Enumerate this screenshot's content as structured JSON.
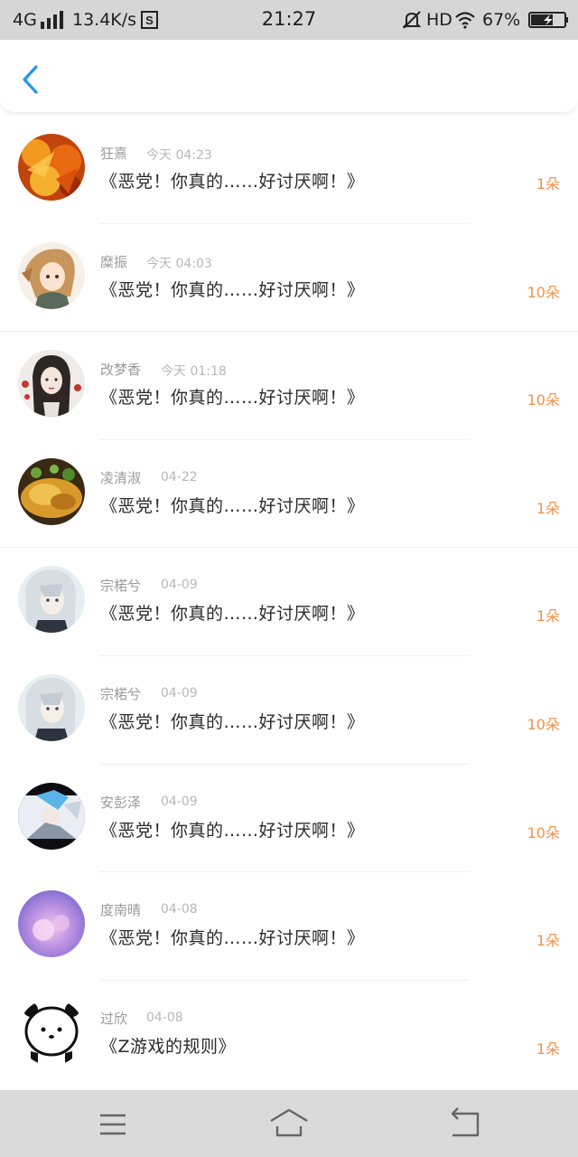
{
  "status_bar": {
    "network": "4G",
    "speed": "13.4K/s",
    "time": "21:27",
    "hd": "HD",
    "battery": "67%"
  },
  "header": {
    "back_icon": "chevron-left-icon",
    "accent": "#2196f3"
  },
  "colors": {
    "count": "#f0924a",
    "name": "#9a9a9a",
    "time": "#b8b8b8"
  },
  "items": [
    {
      "name": "狂熹",
      "time": "今天 04:23",
      "title": "《恶党！你真的……好讨厌啊！》",
      "count": "1朵"
    },
    {
      "name": "糜振",
      "time": "今天 04:03",
      "title": "《恶党！你真的……好讨厌啊！》",
      "count": "10朵"
    },
    {
      "name": "改梦香",
      "time": "今天 01:18",
      "title": "《恶党！你真的……好讨厌啊！》",
      "count": "10朵"
    },
    {
      "name": "凌清淑",
      "time": "04-22",
      "title": "《恶党！你真的……好讨厌啊！》",
      "count": "1朵"
    },
    {
      "name": "宗楉兮",
      "time": "04-09",
      "title": "《恶党！你真的……好讨厌啊！》",
      "count": "1朵"
    },
    {
      "name": "宗楉兮",
      "time": "04-09",
      "title": "《恶党！你真的……好讨厌啊！》",
      "count": "10朵"
    },
    {
      "name": "安彭泽",
      "time": "04-09",
      "title": "《恶党！你真的……好讨厌啊！》",
      "count": "10朵"
    },
    {
      "name": "度南晴",
      "time": "04-08",
      "title": "《恶党！你真的……好讨厌啊！》",
      "count": "1朵"
    },
    {
      "name": "过欣",
      "time": "04-08",
      "title": "《Z游戏的规则》",
      "count": "1朵"
    }
  ],
  "nav_bar": {
    "menu_icon": "menu-icon",
    "home_icon": "home-icon",
    "back_icon": "back-icon"
  }
}
